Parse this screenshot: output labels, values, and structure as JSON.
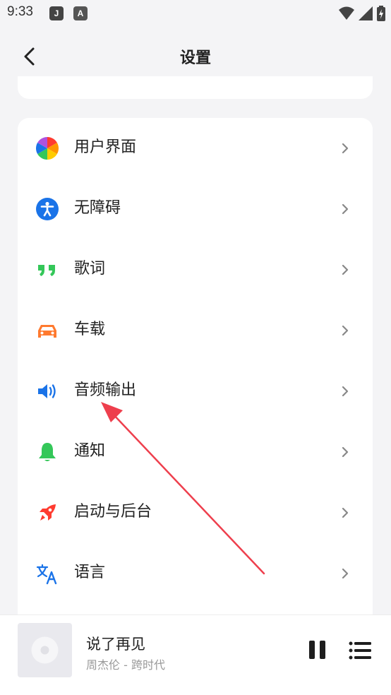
{
  "status_bar": {
    "time": "9:33",
    "app_icons": [
      "J",
      "A"
    ]
  },
  "header": {
    "title": "设置"
  },
  "settings": {
    "items": [
      {
        "label": "用户界面",
        "icon": "palette-icon"
      },
      {
        "label": "无障碍",
        "icon": "accessibility-icon"
      },
      {
        "label": "歌词",
        "icon": "quote-icon"
      },
      {
        "label": "车载",
        "icon": "car-icon"
      },
      {
        "label": "音频输出",
        "icon": "speaker-icon"
      },
      {
        "label": "通知",
        "icon": "bell-icon"
      },
      {
        "label": "启动与后台",
        "icon": "rocket-icon"
      },
      {
        "label": "语言",
        "icon": "translate-icon"
      }
    ]
  },
  "player": {
    "song_title": "说了再见",
    "song_subtitle": "周杰伦 - 跨时代"
  },
  "colors": {
    "accessibility": "#1a73e8",
    "lyrics": "#34c759",
    "car": "#ff7a2f",
    "speaker": "#1a73e8",
    "bell": "#34c759",
    "rocket": "#ff3b30",
    "translate": "#1a73e8",
    "annotation_arrow": "#ee3f4d"
  }
}
